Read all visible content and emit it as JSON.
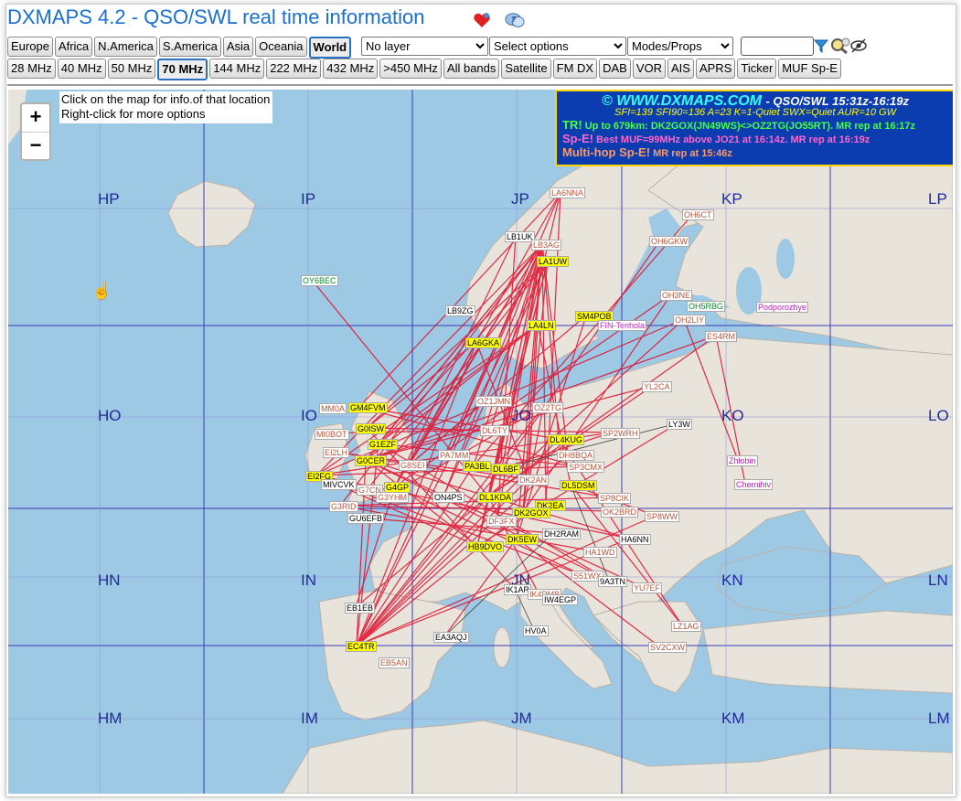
{
  "header": {
    "title": "DXMAPS 4.2 - QSO/SWL real time information",
    "heart_icon": "heart-icon",
    "help_icon": "chat-help-icon"
  },
  "regions": [
    "Europe",
    "Africa",
    "N.America",
    "S.America",
    "Asia",
    "Oceania",
    "World"
  ],
  "regions_selected": "World",
  "layer_select": "No layer",
  "options_select": "Select options",
  "modes_select": "Modes/Props",
  "search": {
    "value": "",
    "placeholder": ""
  },
  "toolbar_icons": [
    "filter-icon",
    "zoom-search-icon",
    "hide-icon"
  ],
  "bands": [
    "28 MHz",
    "40 MHz",
    "50 MHz",
    "70 MHz",
    "144 MHz",
    "222 MHz",
    "432 MHz",
    ">450 MHz",
    "All bands",
    "Satellite",
    "FM DX",
    "DAB",
    "VOR",
    "AIS",
    "APRS",
    "Ticker",
    "MUF Sp-E"
  ],
  "bands_selected": "70 MHz",
  "map": {
    "zoom_in": "+",
    "zoom_out": "−",
    "hint_1": "Click on the map for info.of that location",
    "hint_2": "Right-click for more options",
    "grid": [
      {
        "label": "HP",
        "col": 0,
        "row": 0
      },
      {
        "label": "IP",
        "col": 1,
        "row": 0
      },
      {
        "label": "JP",
        "col": 2,
        "row": 0
      },
      {
        "label": "KP",
        "col": 3,
        "row": 0
      },
      {
        "label": "LP",
        "col": 4,
        "row": 0
      },
      {
        "label": "HO",
        "col": 0,
        "row": 1
      },
      {
        "label": "IO",
        "col": 1,
        "row": 1
      },
      {
        "label": "JO",
        "col": 2,
        "row": 1
      },
      {
        "label": "KO",
        "col": 3,
        "row": 1
      },
      {
        "label": "LO",
        "col": 4,
        "row": 1
      },
      {
        "label": "HN",
        "col": 0,
        "row": 2
      },
      {
        "label": "IN",
        "col": 1,
        "row": 2
      },
      {
        "label": "JN",
        "col": 2,
        "row": 2
      },
      {
        "label": "KN",
        "col": 3,
        "row": 2
      },
      {
        "label": "LN",
        "col": 4,
        "row": 2
      },
      {
        "label": "HM",
        "col": 0,
        "row": 3
      },
      {
        "label": "IM",
        "col": 1,
        "row": 3
      },
      {
        "label": "JM",
        "col": 2,
        "row": 3
      },
      {
        "label": "KM",
        "col": 3,
        "row": 3
      },
      {
        "label": "LM",
        "col": 4,
        "row": 3
      }
    ]
  },
  "info": {
    "site": "© WWW.DXMAPS.COM",
    "period": "- QSO/SWL 15:31z-16:19z",
    "indices": "SFI=139 SFI90=136 A=23 K=1-Quiet SWX=Quiet AUR=10 GW",
    "tr_tag": "TR!",
    "tr_text": "Up to 679km: DK2GOX(JN49WS)<>OZ2TG(JO55RT). MR rep at 16:17z",
    "spe_tag": "Sp-E!",
    "spe_text": "Best MUF=99MHz above JO21 at 16:14z. MR rep at 16:19z",
    "mhop_tag": "Multi-hop Sp-E!",
    "mhop_text": "MR rep at 15:46z"
  },
  "stations": [
    {
      "call": "LA6NNA",
      "s": "o"
    },
    {
      "call": "LB1UK",
      "s": "w"
    },
    {
      "call": "LB3AG",
      "s": "o"
    },
    {
      "call": "LA1UW",
      "s": "y"
    },
    {
      "call": "OH6CT",
      "s": "o"
    },
    {
      "call": "OH6GKW",
      "s": "o"
    },
    {
      "call": "OY6BEC",
      "s": "g"
    },
    {
      "call": "LB9ZG",
      "s": "w"
    },
    {
      "call": "OH3NE",
      "s": "o"
    },
    {
      "call": "OH5RBG",
      "s": "g"
    },
    {
      "call": "Podporozhye",
      "s": "m"
    },
    {
      "call": "SM4POB",
      "s": "y"
    },
    {
      "call": "LA4LN",
      "s": "y"
    },
    {
      "call": "FIN-Tenhola",
      "s": "m"
    },
    {
      "call": "OH2LIY",
      "s": "o"
    },
    {
      "call": "LA6GKA",
      "s": "y"
    },
    {
      "call": "ES4RM",
      "s": "o"
    },
    {
      "call": "OZ1JMN",
      "s": "o"
    },
    {
      "call": "YL2CA",
      "s": "o"
    },
    {
      "call": "MM0A",
      "s": "o"
    },
    {
      "call": "GM4FVM",
      "s": "y"
    },
    {
      "call": "OZ2TG",
      "s": "o"
    },
    {
      "call": "LY3W",
      "s": "w"
    },
    {
      "call": "G0ISW",
      "s": "y"
    },
    {
      "call": "DL6TY",
      "s": "o"
    },
    {
      "call": "SP2WRH",
      "s": "o"
    },
    {
      "call": "MI0BOT",
      "s": "o"
    },
    {
      "call": "G1EZF",
      "s": "y"
    },
    {
      "call": "DL4KUG",
      "s": "y"
    },
    {
      "call": "EI2LH",
      "s": "o"
    },
    {
      "call": "PA7MM",
      "s": "o"
    },
    {
      "call": "DH8BQA",
      "s": "o"
    },
    {
      "call": "G0CER",
      "s": "y"
    },
    {
      "call": "G8SEI",
      "s": "o"
    },
    {
      "call": "PA3BL",
      "s": "y"
    },
    {
      "call": "DL6BF",
      "s": "y"
    },
    {
      "call": "SP3CMX",
      "s": "o"
    },
    {
      "call": "Zhlobin",
      "s": "m"
    },
    {
      "call": "EI2FG",
      "s": "y"
    },
    {
      "call": "MIVCVK",
      "s": "w"
    },
    {
      "call": "G4GP",
      "s": "y"
    },
    {
      "call": "DK2AN",
      "s": "o"
    },
    {
      "call": "DL5DSM",
      "s": "y"
    },
    {
      "call": "Chernihiv",
      "s": "m"
    },
    {
      "call": "G7CN",
      "s": "o"
    },
    {
      "call": "ON4PS",
      "s": "w"
    },
    {
      "call": "DL1KDA",
      "s": "y"
    },
    {
      "call": "SP8CIK",
      "s": "o"
    },
    {
      "call": "G3YHM",
      "s": "o"
    },
    {
      "call": "DK2EA",
      "s": "y"
    },
    {
      "call": "G3RID",
      "s": "o"
    },
    {
      "call": "DK2GOX",
      "s": "y"
    },
    {
      "call": "OK2BRD",
      "s": "o"
    },
    {
      "call": "DF3FX",
      "s": "o"
    },
    {
      "call": "SP8WW",
      "s": "o"
    },
    {
      "call": "GU6EFB",
      "s": "w"
    },
    {
      "call": "DH2RAM",
      "s": "w"
    },
    {
      "call": "DK5EW",
      "s": "y"
    },
    {
      "call": "HA6NN",
      "s": "w"
    },
    {
      "call": "HB9DVO",
      "s": "y"
    },
    {
      "call": "HA1WD",
      "s": "o"
    },
    {
      "call": "S51WX",
      "s": "o"
    },
    {
      "call": "9A3TN",
      "s": "w"
    },
    {
      "call": "YU7EF",
      "s": "o"
    },
    {
      "call": "IK1AR",
      "s": "w"
    },
    {
      "call": "IK4PMB",
      "s": "o"
    },
    {
      "call": "IW4EGP",
      "s": "w"
    },
    {
      "call": "EB1EB",
      "s": "w"
    },
    {
      "call": "LZ1AG",
      "s": "o"
    },
    {
      "call": "HV0A",
      "s": "w"
    },
    {
      "call": "EA3AQJ",
      "s": "w"
    },
    {
      "call": "EC4TR",
      "s": "y"
    },
    {
      "call": "SV2CXW",
      "s": "o"
    },
    {
      "call": "EB5AN",
      "s": "o"
    }
  ]
}
